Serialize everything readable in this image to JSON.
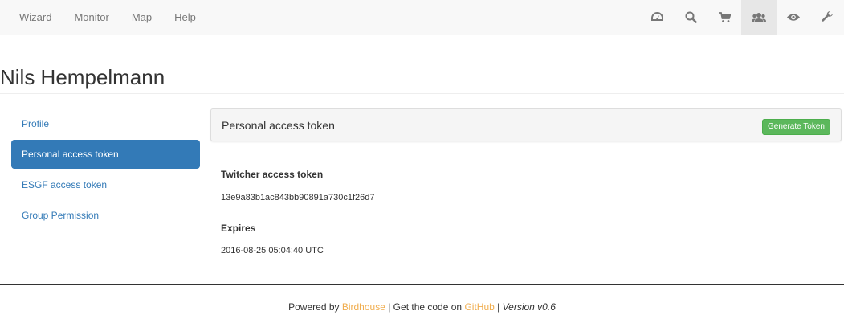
{
  "nav": {
    "left": [
      "Wizard",
      "Monitor",
      "Map",
      "Help"
    ],
    "icons": [
      "dashboard-icon",
      "search-icon",
      "cart-icon",
      "users-icon",
      "eye-icon",
      "wrench-icon"
    ],
    "active_icon": "users-icon"
  },
  "page": {
    "title": "Nils Hempelmann"
  },
  "sidebar": {
    "items": [
      {
        "label": "Profile"
      },
      {
        "label": "Personal access token"
      },
      {
        "label": "ESGF access token"
      },
      {
        "label": "Group Permission"
      }
    ],
    "active_index": 1
  },
  "panel": {
    "title": "Personal access token",
    "button": "Generate Token",
    "token_label": "Twitcher access token",
    "token_value": "13e9a83b1ac843bb90891a730c1f26d7",
    "expires_label": "Expires",
    "expires_value": "2016-08-25 05:04:40 UTC"
  },
  "footer": {
    "powered": "Powered by",
    "birdhouse": "Birdhouse",
    "sep1": "| Get the code on",
    "github": "GitHub",
    "sep2": "|",
    "version": "Version v0.6"
  },
  "colors": {
    "primary": "#337ab7",
    "success": "#5cb85c",
    "link_footer": "#f0ad4e",
    "navbar_bg": "#f8f8f8"
  }
}
